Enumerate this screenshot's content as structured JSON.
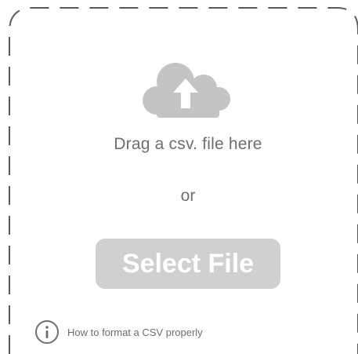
{
  "dropzone": {
    "drag_text": "Drag a csv. file here",
    "or_text": "or",
    "select_button_label": "Select File",
    "upload_icon": "cloud-upload-icon"
  },
  "help": {
    "icon": "info-icon",
    "link_text": "How to format a CSV properly"
  },
  "colors": {
    "icon_gray": "#c4c4c4",
    "text_gray": "#6e6e6e",
    "button_bg": "#d0d0d0",
    "button_text": "#ffffff",
    "border_dash": "#5a5a5a"
  }
}
